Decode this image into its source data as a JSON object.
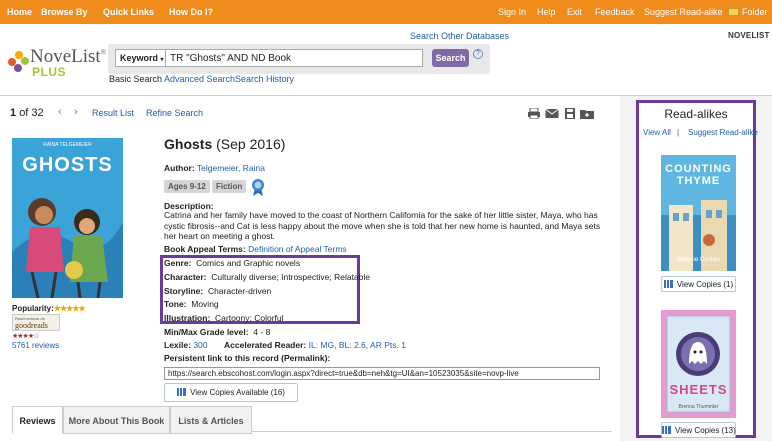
{
  "topnav": {
    "left": [
      "Home",
      "Browse By",
      "Quick Links",
      "How Do I?"
    ],
    "right": [
      "Sign In",
      "Help",
      "Exit",
      "Feedback",
      "Suggest Read-alike",
      "Folder"
    ]
  },
  "header": {
    "search_other": "Search Other Databases",
    "product_label": "NOVELIST",
    "logo_text": "NoveList",
    "logo_plus": "PLUS",
    "field_select": "Keyword",
    "query": "TR \"Ghosts\" AND ND Book",
    "search_button": "Search",
    "help": "?",
    "subnav": [
      "Basic Search",
      "Advanced Search",
      "Search History"
    ]
  },
  "pager": {
    "current": "1",
    "of_text": "of 32",
    "prev": "‹",
    "next": "›",
    "result_list": "Result List",
    "refine_search": "Refine Search"
  },
  "book": {
    "title": "Ghosts",
    "date": "(Sep 2016)",
    "cover_title": "GHOSTS",
    "cover_author": "RAINA TELGEMEIER",
    "author_label": "Author:",
    "author": "Telgemeier, Raina",
    "tags": [
      "Ages 9-12",
      "Fiction"
    ],
    "description_label": "Description:",
    "description": "Catrina and her family have moved to the coast of Northern California for the sake of her little sister, Maya, who has cystic fibrosis--and Cat is less happy about the move when she is told that her new home is haunted, and Maya sets her heart on meeting a ghost.",
    "appeal_label": "Book Appeal Terms:",
    "appeal_link": "Definition of Appeal Terms",
    "appeal": [
      {
        "label": "Genre:",
        "value": "Comics and Graphic novels"
      },
      {
        "label": "Character:",
        "value": "Culturally diverse; Introspective; Relatable"
      },
      {
        "label": "Storyline:",
        "value": "Character-driven"
      },
      {
        "label": "Tone:",
        "value": "Moving"
      },
      {
        "label": "Illustration:",
        "value": "Cartoony; Colorful"
      }
    ],
    "grade_label": "Min/Max Grade level:",
    "grade": "4 - 8",
    "lexile_label": "Lexile:",
    "lexile": "300",
    "ar_label": "Accelerated Reader:",
    "ar": "IL: MG, BL: 2.6, AR Pts. 1",
    "permalink_label": "Persistent link to this record (Permalink):",
    "permalink": "https://search.ebscohost.com/login.aspx?direct=true&db=neh&tg=UI&an=10523035&site=novp-live",
    "copies_button": "View Copies Available (16)",
    "popularity_label": "Popularity:",
    "popularity_stars": "★★★★★",
    "goodreads_top": "Read reviews on",
    "goodreads_brand": "goodreads",
    "goodreads_stars": "★★★★☆",
    "reviews_count": "5761 reviews"
  },
  "tabs": [
    "Reviews",
    "More About This Book",
    "Lists & Articles"
  ],
  "readalikes": {
    "title": "Read-alikes",
    "view_all": "View All",
    "separator": "|",
    "suggest": "Suggest Read-alike",
    "items": [
      {
        "cover_title": "COUNTING THYME",
        "cover_author": "Melanie Conklin",
        "copies": "View Copies (1)"
      },
      {
        "cover_title": "SHEETS",
        "cover_author": "Brenna Thummler",
        "copies": "View Copies (13)"
      }
    ]
  },
  "colors": {
    "topbar": "#f08c1c",
    "accent_purple": "#6c3a98",
    "link_blue": "#1f5fa8",
    "search_button": "#7f6aa8"
  }
}
